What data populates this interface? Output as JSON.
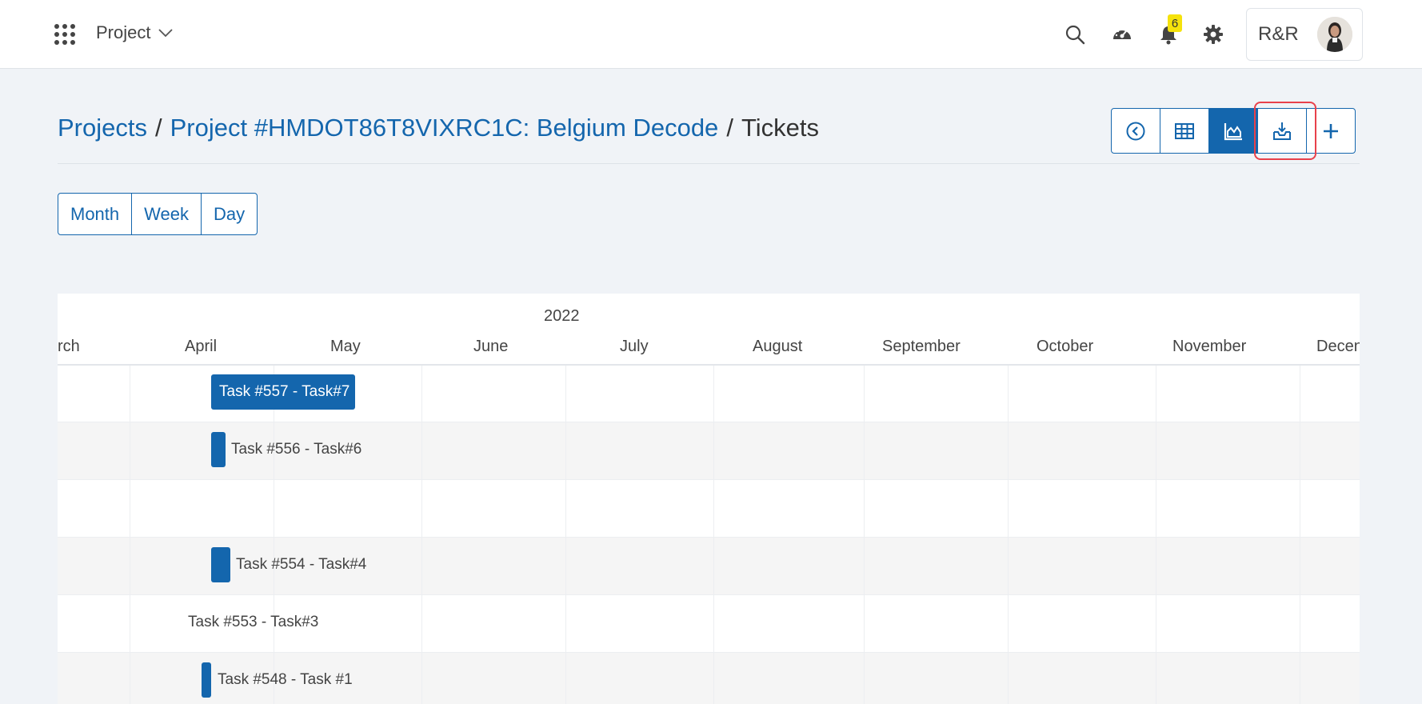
{
  "topbar": {
    "apps_icon": "apps-grid-icon",
    "project_menu": "Project",
    "icons": [
      "search-icon",
      "dashboard-gauge-icon",
      "bell-icon",
      "gear-icon"
    ],
    "notification_count": "6",
    "user_name": "R&R"
  },
  "breadcrumb": {
    "projects": "Projects",
    "separator": "/",
    "project": "Project #HMDOT86T8VIXRC1C: Belgium Decode",
    "current": "Tickets"
  },
  "toolbar": {
    "buttons": [
      "back-circle-icon",
      "table-grid-icon",
      "area-chart-icon",
      "download-tray-icon",
      "plus-icon"
    ],
    "active": "area-chart-icon",
    "highlighted": "download-tray-icon"
  },
  "view_modes": [
    "Month",
    "Week",
    "Day"
  ],
  "gantt": {
    "year": "2022",
    "months": [
      "rch",
      "April",
      "May",
      "June",
      "July",
      "August",
      "September",
      "October",
      "November",
      "Decen"
    ],
    "rows": [
      {
        "label": "Task #557 - Task#7",
        "style": "bar"
      },
      {
        "label": "Task #556 - Task#6",
        "style": "marker"
      },
      {
        "label": "",
        "style": "empty"
      },
      {
        "label": "Task #554 - Task#4",
        "style": "marker"
      },
      {
        "label": "Task #553 - Task#3",
        "style": "text"
      },
      {
        "label": "Task #548 - Task #1",
        "style": "marker"
      }
    ]
  },
  "colors": {
    "accent": "#1466ad",
    "highlight": "#e8414b",
    "badge": "#f5e20c",
    "background": "#f0f3f7"
  }
}
